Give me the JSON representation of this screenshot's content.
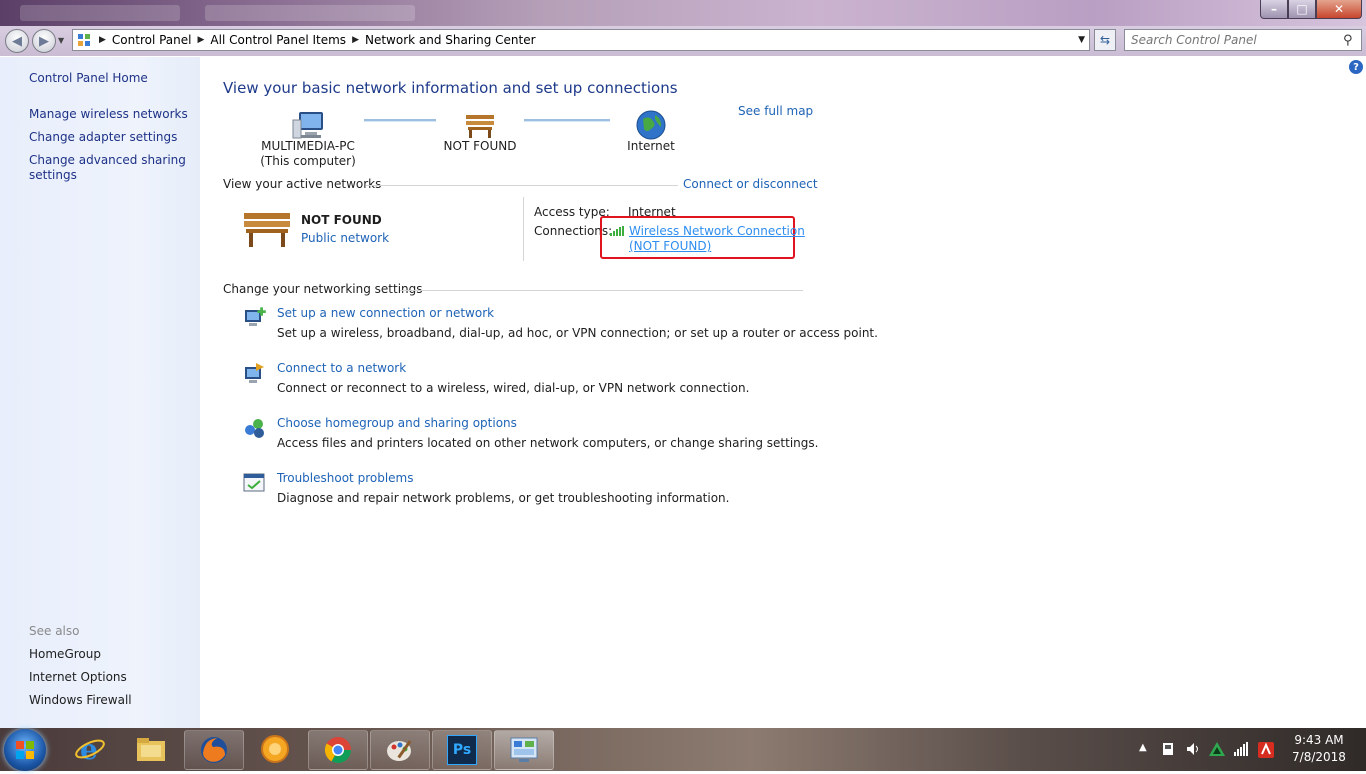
{
  "window": {
    "minimize_glyph": "–",
    "maximize_glyph": "□",
    "close_glyph": "✕"
  },
  "address": {
    "crumbs": [
      "Control Panel",
      "All Control Panel Items",
      "Network and Sharing Center"
    ],
    "search_placeholder": "Search Control Panel"
  },
  "sidebar": {
    "home": "Control Panel Home",
    "items": [
      "Manage wireless networks",
      "Change adapter settings",
      "Change advanced sharing settings"
    ],
    "see_also_title": "See also",
    "see_also": [
      "HomeGroup",
      "Internet Options",
      "Windows Firewall"
    ]
  },
  "main": {
    "title": "View your basic network information and set up connections",
    "see_full_map": "See full map",
    "map": {
      "computer_name": "MULTIMEDIA-PC",
      "computer_sub": "(This computer)",
      "network_name": "NOT FOUND",
      "internet": "Internet"
    },
    "active_title": "View your active networks",
    "connect_disconnect": "Connect or disconnect",
    "active": {
      "name": "NOT FOUND",
      "category": "Public network",
      "access_type_label": "Access type:",
      "access_type_value": "Internet",
      "connections_label": "Connections:",
      "connection_line1": "Wireless Network Connection",
      "connection_line2": "(NOT FOUND)"
    },
    "settings_title": "Change your networking settings",
    "tasks": [
      {
        "title": "Set up a new connection or network",
        "desc": "Set up a wireless, broadband, dial-up, ad hoc, or VPN connection; or set up a router or access point.",
        "icon": "new-connection-icon"
      },
      {
        "title": "Connect to a network",
        "desc": "Connect or reconnect to a wireless, wired, dial-up, or VPN network connection.",
        "icon": "connect-network-icon"
      },
      {
        "title": "Choose homegroup and sharing options",
        "desc": "Access files and printers located on other network computers, or change sharing settings.",
        "icon": "homegroup-icon"
      },
      {
        "title": "Troubleshoot problems",
        "desc": "Diagnose and repair network problems, or get troubleshooting information.",
        "icon": "troubleshoot-icon"
      }
    ]
  },
  "taskbar": {
    "apps": [
      "internet-explorer-icon",
      "file-explorer-icon",
      "firefox-icon",
      "app-orange-icon",
      "chrome-icon",
      "paint-icon",
      "photoshop-icon",
      "control-panel-icon"
    ],
    "photoshop_label": "Ps",
    "time": "9:43 AM",
    "date": "7/8/2018"
  },
  "colors": {
    "link": "#1e63b6",
    "heading": "#1e3a8a",
    "highlight_box": "#e0141e"
  }
}
